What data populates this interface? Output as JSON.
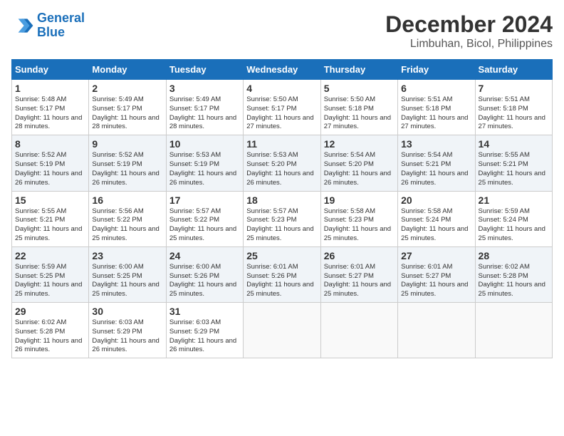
{
  "logo": {
    "line1": "General",
    "line2": "Blue"
  },
  "title": "December 2024",
  "subtitle": "Limbuhan, Bicol, Philippines",
  "weekdays": [
    "Sunday",
    "Monday",
    "Tuesday",
    "Wednesday",
    "Thursday",
    "Friday",
    "Saturday"
  ],
  "weeks": [
    [
      {
        "day": 1,
        "sunrise": "5:48 AM",
        "sunset": "5:17 PM",
        "daylight": "11 hours and 28 minutes."
      },
      {
        "day": 2,
        "sunrise": "5:49 AM",
        "sunset": "5:17 PM",
        "daylight": "11 hours and 28 minutes."
      },
      {
        "day": 3,
        "sunrise": "5:49 AM",
        "sunset": "5:17 PM",
        "daylight": "11 hours and 28 minutes."
      },
      {
        "day": 4,
        "sunrise": "5:50 AM",
        "sunset": "5:17 PM",
        "daylight": "11 hours and 27 minutes."
      },
      {
        "day": 5,
        "sunrise": "5:50 AM",
        "sunset": "5:18 PM",
        "daylight": "11 hours and 27 minutes."
      },
      {
        "day": 6,
        "sunrise": "5:51 AM",
        "sunset": "5:18 PM",
        "daylight": "11 hours and 27 minutes."
      },
      {
        "day": 7,
        "sunrise": "5:51 AM",
        "sunset": "5:18 PM",
        "daylight": "11 hours and 27 minutes."
      }
    ],
    [
      {
        "day": 8,
        "sunrise": "5:52 AM",
        "sunset": "5:19 PM",
        "daylight": "11 hours and 26 minutes."
      },
      {
        "day": 9,
        "sunrise": "5:52 AM",
        "sunset": "5:19 PM",
        "daylight": "11 hours and 26 minutes."
      },
      {
        "day": 10,
        "sunrise": "5:53 AM",
        "sunset": "5:19 PM",
        "daylight": "11 hours and 26 minutes."
      },
      {
        "day": 11,
        "sunrise": "5:53 AM",
        "sunset": "5:20 PM",
        "daylight": "11 hours and 26 minutes."
      },
      {
        "day": 12,
        "sunrise": "5:54 AM",
        "sunset": "5:20 PM",
        "daylight": "11 hours and 26 minutes."
      },
      {
        "day": 13,
        "sunrise": "5:54 AM",
        "sunset": "5:21 PM",
        "daylight": "11 hours and 26 minutes."
      },
      {
        "day": 14,
        "sunrise": "5:55 AM",
        "sunset": "5:21 PM",
        "daylight": "11 hours and 25 minutes."
      }
    ],
    [
      {
        "day": 15,
        "sunrise": "5:55 AM",
        "sunset": "5:21 PM",
        "daylight": "11 hours and 25 minutes."
      },
      {
        "day": 16,
        "sunrise": "5:56 AM",
        "sunset": "5:22 PM",
        "daylight": "11 hours and 25 minutes."
      },
      {
        "day": 17,
        "sunrise": "5:57 AM",
        "sunset": "5:22 PM",
        "daylight": "11 hours and 25 minutes."
      },
      {
        "day": 18,
        "sunrise": "5:57 AM",
        "sunset": "5:23 PM",
        "daylight": "11 hours and 25 minutes."
      },
      {
        "day": 19,
        "sunrise": "5:58 AM",
        "sunset": "5:23 PM",
        "daylight": "11 hours and 25 minutes."
      },
      {
        "day": 20,
        "sunrise": "5:58 AM",
        "sunset": "5:24 PM",
        "daylight": "11 hours and 25 minutes."
      },
      {
        "day": 21,
        "sunrise": "5:59 AM",
        "sunset": "5:24 PM",
        "daylight": "11 hours and 25 minutes."
      }
    ],
    [
      {
        "day": 22,
        "sunrise": "5:59 AM",
        "sunset": "5:25 PM",
        "daylight": "11 hours and 25 minutes."
      },
      {
        "day": 23,
        "sunrise": "6:00 AM",
        "sunset": "5:25 PM",
        "daylight": "11 hours and 25 minutes."
      },
      {
        "day": 24,
        "sunrise": "6:00 AM",
        "sunset": "5:26 PM",
        "daylight": "11 hours and 25 minutes."
      },
      {
        "day": 25,
        "sunrise": "6:01 AM",
        "sunset": "5:26 PM",
        "daylight": "11 hours and 25 minutes."
      },
      {
        "day": 26,
        "sunrise": "6:01 AM",
        "sunset": "5:27 PM",
        "daylight": "11 hours and 25 minutes."
      },
      {
        "day": 27,
        "sunrise": "6:01 AM",
        "sunset": "5:27 PM",
        "daylight": "11 hours and 25 minutes."
      },
      {
        "day": 28,
        "sunrise": "6:02 AM",
        "sunset": "5:28 PM",
        "daylight": "11 hours and 25 minutes."
      }
    ],
    [
      {
        "day": 29,
        "sunrise": "6:02 AM",
        "sunset": "5:28 PM",
        "daylight": "11 hours and 26 minutes."
      },
      {
        "day": 30,
        "sunrise": "6:03 AM",
        "sunset": "5:29 PM",
        "daylight": "11 hours and 26 minutes."
      },
      {
        "day": 31,
        "sunrise": "6:03 AM",
        "sunset": "5:29 PM",
        "daylight": "11 hours and 26 minutes."
      },
      null,
      null,
      null,
      null
    ]
  ]
}
